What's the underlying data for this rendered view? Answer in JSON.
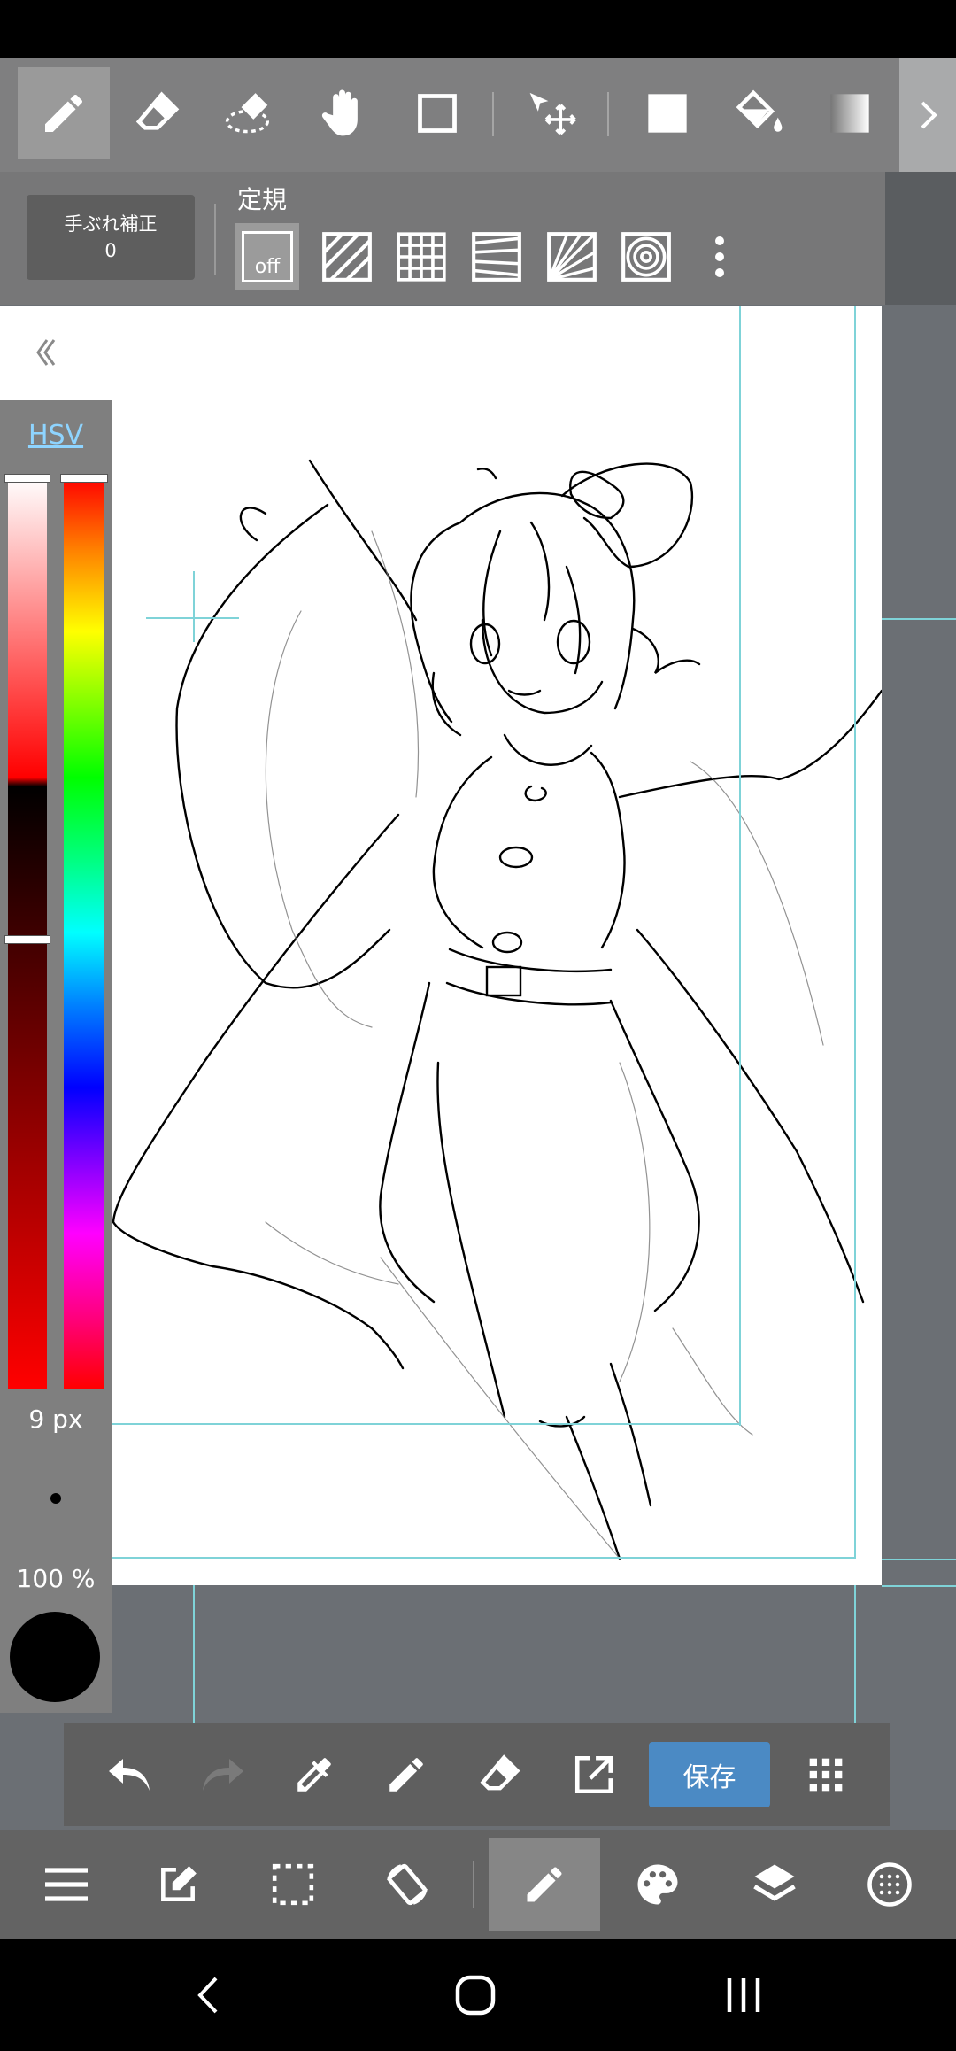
{
  "toolbar_top": {
    "tools": [
      {
        "icon": "pen-icon",
        "active": true
      },
      {
        "icon": "eraser-icon",
        "active": false
      },
      {
        "icon": "blur-eraser-icon",
        "active": false
      },
      {
        "icon": "hand-icon",
        "active": false
      },
      {
        "icon": "rectangle-icon",
        "active": false
      },
      {
        "icon": "move-icon",
        "active": false
      },
      {
        "icon": "fill-rect-icon",
        "active": false
      },
      {
        "icon": "bucket-icon",
        "active": false
      },
      {
        "icon": "gradient-icon",
        "active": false
      }
    ],
    "expand_icon": "chevron-right-icon"
  },
  "ruler_bar": {
    "stabilizer_label": "手ぶれ補正",
    "stabilizer_value": "0",
    "ruler_label": "定規",
    "ruler_off_label": "off",
    "rulers": [
      "off",
      "parallel",
      "grid",
      "perspective-lines",
      "radial",
      "concentric"
    ]
  },
  "color_panel": {
    "mode_label": "HSV",
    "brush_size": "9 px",
    "opacity": "100 %",
    "current_color": "#000000"
  },
  "action_bar": {
    "save_label": "保存",
    "buttons": [
      "undo-icon",
      "redo-icon",
      "eyedropper-icon",
      "pen-icon",
      "eraser-icon",
      "export-icon",
      "grid-menu-icon"
    ]
  },
  "menu_bar": {
    "items": [
      "menu-icon",
      "edit-icon",
      "selection-icon",
      "rotate-icon",
      "brush-icon",
      "palette-icon",
      "layers-icon",
      "material-icon"
    ],
    "active": "brush-icon"
  },
  "colors": {
    "accent": "#4b8ac4",
    "hsv_link": "#8ed4ff",
    "guide": "#7fd3d8"
  }
}
